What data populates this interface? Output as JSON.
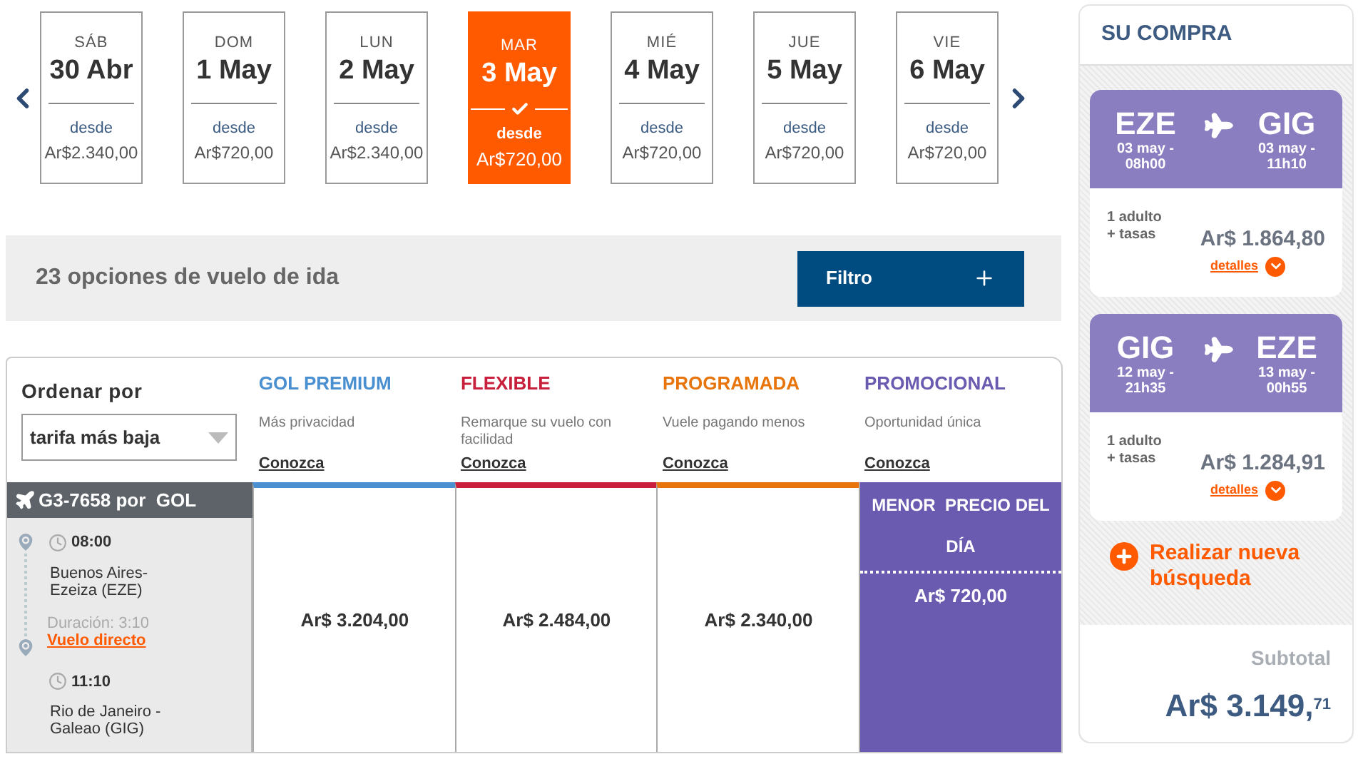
{
  "dates": [
    {
      "weekday": "SÁB",
      "date": "30 Abr",
      "from": "desde",
      "price": "Ar$2.340,00",
      "selected": false
    },
    {
      "weekday": "DOM",
      "date": "1 May",
      "from": "desde",
      "price": "Ar$720,00",
      "selected": false
    },
    {
      "weekday": "LUN",
      "date": "2 May",
      "from": "desde",
      "price": "Ar$2.340,00",
      "selected": false
    },
    {
      "weekday": "MAR",
      "date": "3 May",
      "from": "desde",
      "price": "Ar$720,00",
      "selected": true
    },
    {
      "weekday": "MIÉ",
      "date": "4 May",
      "from": "desde",
      "price": "Ar$720,00",
      "selected": false
    },
    {
      "weekday": "JUE",
      "date": "5 May",
      "from": "desde",
      "price": "Ar$720,00",
      "selected": false
    },
    {
      "weekday": "VIE",
      "date": "6 May",
      "from": "desde",
      "price": "Ar$720,00",
      "selected": false
    }
  ],
  "results_bar": {
    "count": "23 opciones de vuelo de ida",
    "filter_button": "Filtro"
  },
  "sort": {
    "label": "Ordenar por",
    "value": "tarifa más baja"
  },
  "flight": {
    "title": "G3-7658 por  GOL",
    "departure_time": "08:00",
    "origin": "Buenos Aires-Ezeiza (EZE)",
    "duration": "Duración: 3:10",
    "direct_link": "Vuelo directo",
    "arrival_time": "11:10",
    "destination": "Rio de Janeiro - Galeao (GIG)"
  },
  "fares": [
    {
      "name": "GOL PREMIUM",
      "color": "#4a90d0",
      "description": "Más privacidad",
      "link": "Conozca",
      "price": "Ar$ 3.204,00",
      "selected": false
    },
    {
      "name": "FLEXIBLE",
      "color": "#c8203c",
      "description": "Remarque su vuelo con facilidad",
      "link": "Conozca",
      "price": "Ar$ 2.484,00",
      "selected": false
    },
    {
      "name": "PROGRAMADA",
      "color": "#e8740c",
      "description": "Vuele pagando menos",
      "link": "Conozca",
      "price": "Ar$ 2.340,00",
      "selected": false
    },
    {
      "name": "PROMOCIONAL",
      "color": "#6a5ab0",
      "description": "Oportunidad única",
      "link": "Conozca",
      "price": "Ar$ 720,00",
      "selected": true,
      "badge": "MENOR  PRECIO DEL DÍA"
    }
  ],
  "purchase": {
    "title": "SU COMPRA",
    "legs": [
      {
        "from": "EZE",
        "to": "GIG",
        "depart": "03 may - 08h00",
        "arrive": "03 may - 11h10",
        "passengers": "1 adulto + tasas",
        "price": "Ar$ 1.864,80",
        "details": "detalles"
      },
      {
        "from": "GIG",
        "to": "EZE",
        "depart": "12 may - 21h35",
        "arrive": "13 may - 00h55",
        "passengers": "1 adulto + tasas",
        "price": "Ar$ 1.284,91",
        "details": "detalles"
      }
    ],
    "new_search": "Realizar nueva búsqueda",
    "subtotal_label": "Subtotal",
    "subtotal": "Ar$ 3.149,$^{71}$"
  }
}
